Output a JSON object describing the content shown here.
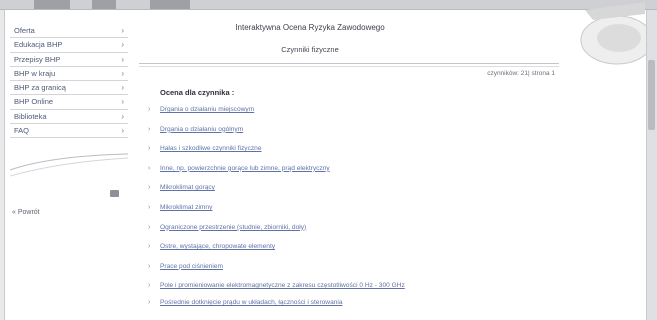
{
  "sidebar": {
    "items": [
      {
        "label": "Oferta"
      },
      {
        "label": "Edukacja BHP"
      },
      {
        "label": "Przepisy BHP"
      },
      {
        "label": "BHP w kraju"
      },
      {
        "label": "BHP za granicą"
      },
      {
        "label": "BHP Online"
      },
      {
        "label": "Biblioteka"
      },
      {
        "label": "FAQ"
      }
    ],
    "back_label": "« Powrót"
  },
  "main": {
    "title": "Interaktywna Ocena Ryzyka Zawodowego",
    "subtitle": "Czynniki fizyczne",
    "counter": "czynników: 21| strona 1",
    "heading": "Ocena dla czynnika :",
    "items": [
      "Drgania o działaniu miejscowym",
      "Drgania o działaniu ogólnym",
      "Hałas i szkodliwe czynniki fizyczne",
      "Inne, np. powierzchnie gorące lub zimne, prąd elektryczny",
      "Mikroklimat gorący",
      "Mikroklimat zimny",
      "Ograniczone przestrzenie (studnie, zbiorniki, doły)",
      "Ostre, wystające, chropowate elementy",
      "Prace pod ciśnieniem",
      "Pole i promieniowanie elektromagnetyczne z zakresu częstotliwości 0 Hz - 300 GHz",
      "Pośrednie dotknięcie prądu w układach, łączności i sterowania"
    ]
  },
  "icons": {
    "bullet": "›",
    "menu_arrow": "›"
  },
  "colors": {
    "link": "#5f73a8",
    "menu_text": "#4e5a78",
    "background": "#e9e9ea"
  }
}
